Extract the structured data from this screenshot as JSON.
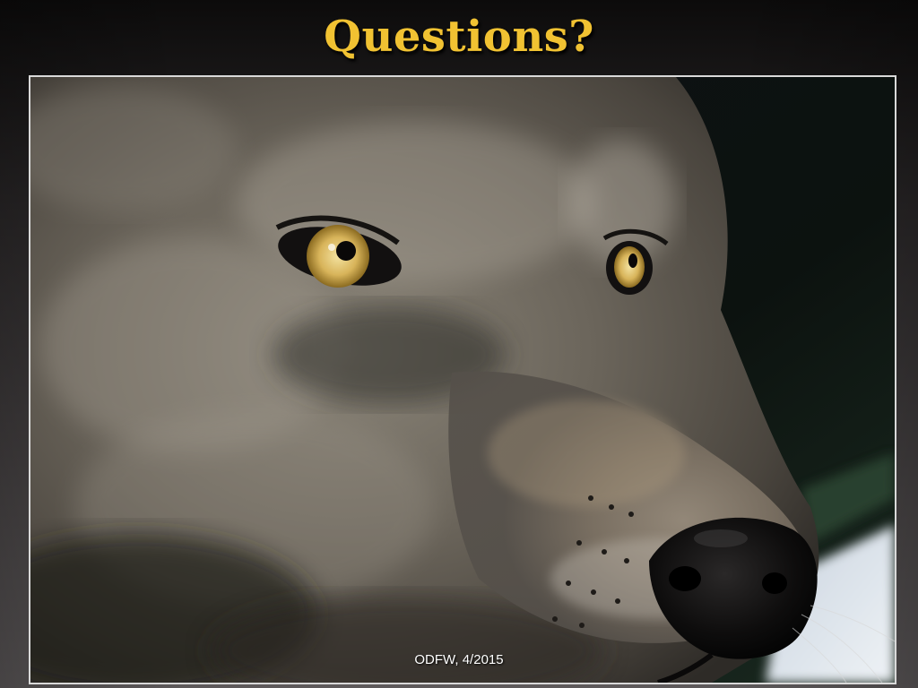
{
  "slide": {
    "title": "Questions?",
    "footer": "ODFW, 4/2015"
  },
  "image": {
    "subject": "wolf-face-photo"
  },
  "colors": {
    "title": "#f1c232",
    "frame_border": "#d9d9d9",
    "footer_text": "#ffffff"
  }
}
